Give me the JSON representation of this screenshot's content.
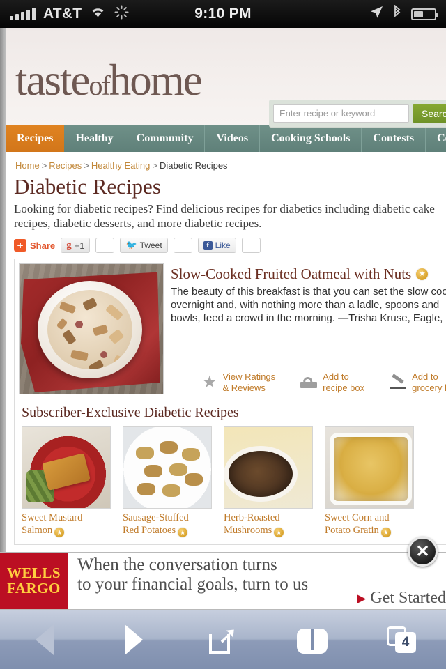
{
  "status_bar": {
    "carrier": "AT&T",
    "time": "9:10 PM",
    "icons": [
      "signal-bars-icon",
      "wifi-icon",
      "activity-spinner-icon",
      "location-arrow-icon",
      "bluetooth-icon",
      "battery-icon"
    ]
  },
  "site": {
    "logo_main": "taste",
    "logo_small": "of",
    "logo_main2": "home",
    "search": {
      "placeholder": "Enter recipe or keyword",
      "value": "",
      "button_label": "Search"
    },
    "nav": [
      {
        "label": "Recipes",
        "active": true
      },
      {
        "label": "Healthy",
        "active": false
      },
      {
        "label": "Community",
        "active": false
      },
      {
        "label": "Videos",
        "active": false
      },
      {
        "label": "Cooking Schools",
        "active": false
      },
      {
        "label": "Contests",
        "active": false
      },
      {
        "label": "Coo",
        "active": false
      }
    ],
    "breadcrumb": {
      "items": [
        "Home",
        "Recipes",
        "Healthy Eating"
      ],
      "current": "Diabetic Recipes",
      "separator": ">"
    },
    "page_title": "Diabetic Recipes",
    "lede": "Looking for diabetic recipes? Find delicious recipes for diabetics including diabetic cake recipes, diabetic desserts, and more diabetic recipes.",
    "social": {
      "share_label": "Share",
      "gplus_label": "+1",
      "gplus_mark": "g",
      "tweet_label": "Tweet",
      "like_label": "Like",
      "facebook_mark": "f",
      "counts": [
        "",
        "",
        ""
      ]
    },
    "featured": {
      "title": "Slow-Cooked Fruited Oatmeal with Nuts",
      "badge": "star-badge-icon",
      "description_line1": "The beauty of this breakfast is that you can set the slow cooker",
      "description_line2": "overnight and, with nothing more than a ladle, spoons and",
      "description_line3": "bowls, feed a crowd in the morning. —Trisha Kruse, Eagle, Idah",
      "actions": [
        {
          "icon": "star-icon",
          "line1": "View Ratings",
          "line2": "& Reviews"
        },
        {
          "icon": "recipe-box-icon",
          "line1": "Add to",
          "line2": "recipe box"
        },
        {
          "icon": "pencil-icon",
          "line1": "Add to",
          "line2": "grocery list"
        }
      ]
    },
    "subscriber_section": {
      "heading": "Subscriber-Exclusive Diabetic Recipes",
      "tiles": [
        {
          "line1": "Sweet Mustard",
          "line2": "Salmon"
        },
        {
          "line1": "Sausage-Stuffed",
          "line2": "Red Potatoes"
        },
        {
          "line1": "Herb-Roasted",
          "line2": "Mushrooms"
        },
        {
          "line1": "Sweet Corn and",
          "line2": "Potato Gratin"
        }
      ]
    }
  },
  "ad": {
    "brand_line1": "WELLS",
    "brand_line2": "FARGO",
    "copy_line1": "When the conversation turns",
    "copy_line2": "to your financial goals, turn to us",
    "cta": "Get Started",
    "cta_arrow": "▶",
    "close_label": "✕"
  },
  "toolbar": {
    "back": "back-arrow-icon",
    "forward": "forward-arrow-icon",
    "share": "share-icon",
    "bookmarks": "bookmarks-icon",
    "tabs_count": "4"
  },
  "colors": {
    "nav_teal": "#6f9088",
    "nav_active_orange": "#d2761a",
    "brand_brown": "#6e5852",
    "title_maroon": "#5c2a22",
    "link_gold": "#c07b2a",
    "search_green": "#86a832",
    "wells_fargo_red": "#bb0f23",
    "wells_fargo_gold": "#ffcf3f"
  }
}
